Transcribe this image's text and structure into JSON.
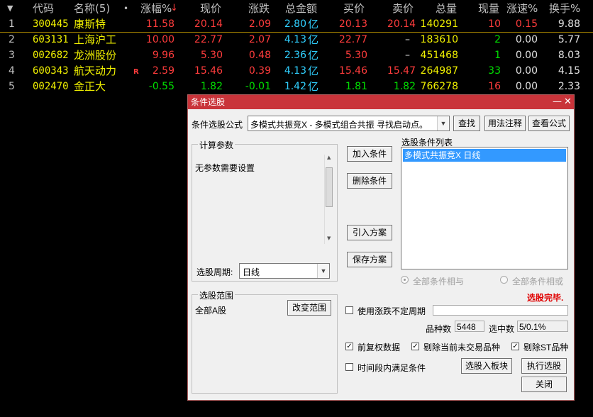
{
  "table": {
    "headers": {
      "sort_arrow": "▼",
      "code": "代码",
      "name": "名称(5)",
      "dot": "•",
      "change_pct": "涨幅%",
      "change_pct_sort": "↓",
      "price": "现价",
      "change": "涨跌",
      "turnover": "总金额",
      "bid": "买价",
      "ask": "卖价",
      "volume": "总量",
      "cur_volume": "现量",
      "speed": "涨速%",
      "turnover_rate": "换手%"
    },
    "rows": [
      {
        "idx": "1",
        "code": "300445",
        "name": "康斯特",
        "flag": "",
        "change_pct": "11.58",
        "price": "20.14",
        "change": "2.09",
        "amount": "2.80",
        "amount_unit": "亿",
        "bid": "20.13",
        "ask": "20.14",
        "volume": "140291",
        "cur": "10",
        "speed": "0.15",
        "rate": "9.88"
      },
      {
        "idx": "2",
        "code": "603131",
        "name": "上海沪工",
        "flag": "",
        "change_pct": "10.00",
        "price": "22.77",
        "change": "2.07",
        "amount": "4.13",
        "amount_unit": "亿",
        "bid": "22.77",
        "ask": "–",
        "volume": "183610",
        "cur": "2",
        "speed": "0.00",
        "rate": "5.77"
      },
      {
        "idx": "3",
        "code": "002682",
        "name": "龙洲股份",
        "flag": "",
        "change_pct": "9.96",
        "price": "5.30",
        "change": "0.48",
        "amount": "2.36",
        "amount_unit": "亿",
        "bid": "5.30",
        "ask": "–",
        "volume": "451468",
        "cur": "1",
        "speed": "0.00",
        "rate": "8.03"
      },
      {
        "idx": "4",
        "code": "600343",
        "name": "航天动力",
        "flag": "R",
        "change_pct": "2.59",
        "price": "15.46",
        "change": "0.39",
        "amount": "4.13",
        "amount_unit": "亿",
        "bid": "15.46",
        "ask": "15.47",
        "volume": "264987",
        "cur": "33",
        "speed": "0.00",
        "rate": "4.15"
      },
      {
        "idx": "5",
        "code": "002470",
        "name": "金正大",
        "flag": "",
        "change_pct": "-0.55",
        "price": "1.82",
        "change": "-0.01",
        "amount": "1.42",
        "amount_unit": "亿",
        "bid": "1.81",
        "ask": "1.82",
        "volume": "766278",
        "cur": "16",
        "speed": "0.00",
        "rate": "2.33"
      }
    ]
  },
  "dialog": {
    "title": "条件选股",
    "min_glyph": "—",
    "close_glyph": "✕",
    "formula_label": "条件选股公式",
    "formula_value": "多模式共振竞X  -  多模式组合共振 寻找启动点。",
    "btn_find": "查找",
    "btn_usage": "用法注释",
    "btn_view": "查看公式",
    "params_group": "计算参数",
    "params_text": "无参数需要设置",
    "period_label": "选股周期:",
    "period_value": "日线",
    "btn_add": "加入条件",
    "btn_delete": "删除条件",
    "btn_import": "引入方案",
    "btn_save": "保存方案",
    "cond_list_label": "选股条件列表",
    "cond_items": [
      "多模式共振竞X  日线"
    ],
    "radio_and": "全部条件相与",
    "radio_or": "全部条件相或",
    "range_group": "选股范围",
    "range_text": "全部A股",
    "btn_change_range": "改变范围",
    "done_text": "选股完毕.",
    "use_uncertain_period": "使用涨跌不定周期",
    "count_label": "品种数",
    "count_value": "5448",
    "selected_label": "选中数",
    "selected_value": "5/0.1%",
    "opt_prev_adj": "前复权数据",
    "opt_exclude_untraded": "剔除当前未交易品种",
    "opt_exclude_st": "剔除ST品种",
    "opt_time_range": "时间段内满足条件",
    "btn_to_block": "选股入板块",
    "btn_execute": "执行选股",
    "btn_close": "关闭",
    "done_color": "#e00000",
    "title_color": "#c9343a"
  }
}
